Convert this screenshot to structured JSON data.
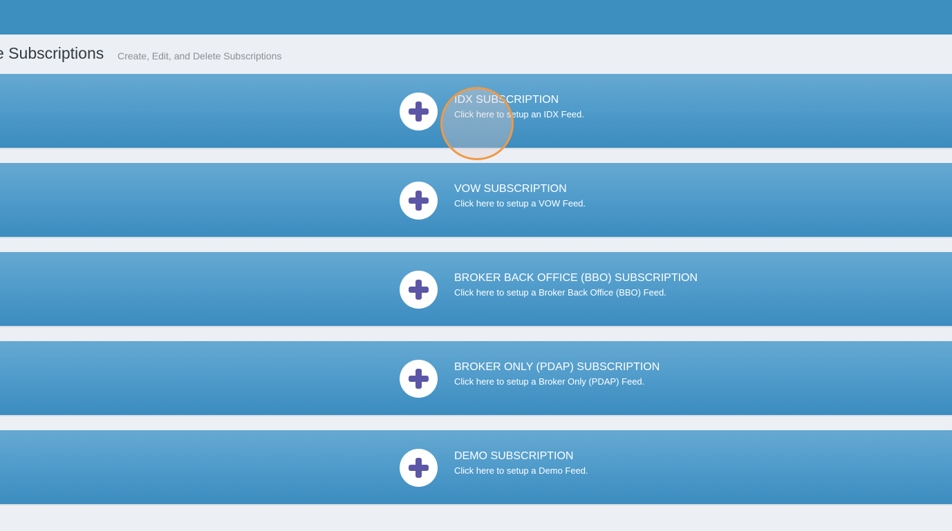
{
  "header": {
    "title": "e Subscriptions",
    "subtitle": "Create, Edit, and Delete Subscriptions"
  },
  "colors": {
    "top_bar": "#3d8fc0",
    "card_gradient_top": "#66a9d3",
    "card_gradient_bottom": "#3c8cbf",
    "plus_icon": "#5b57a6",
    "click_indicator": "#ef9a45",
    "page_background": "#eceff4"
  },
  "subscriptions": [
    {
      "title": "IDX SUBSCRIPTION",
      "description": "Click here to setup an IDX Feed.",
      "icon": "plus-icon"
    },
    {
      "title": "VOW SUBSCRIPTION",
      "description": "Click here to setup a VOW Feed.",
      "icon": "plus-icon"
    },
    {
      "title": "BROKER BACK OFFICE (BBO) SUBSCRIPTION",
      "description": "Click here to setup a Broker Back Office (BBO) Feed.",
      "icon": "plus-icon"
    },
    {
      "title": "BROKER ONLY (PDAP) SUBSCRIPTION",
      "description": "Click here to setup a Broker Only (PDAP) Feed.",
      "icon": "plus-icon"
    },
    {
      "title": "DEMO SUBSCRIPTION",
      "description": "Click here to setup a Demo Feed.",
      "icon": "plus-icon"
    }
  ]
}
